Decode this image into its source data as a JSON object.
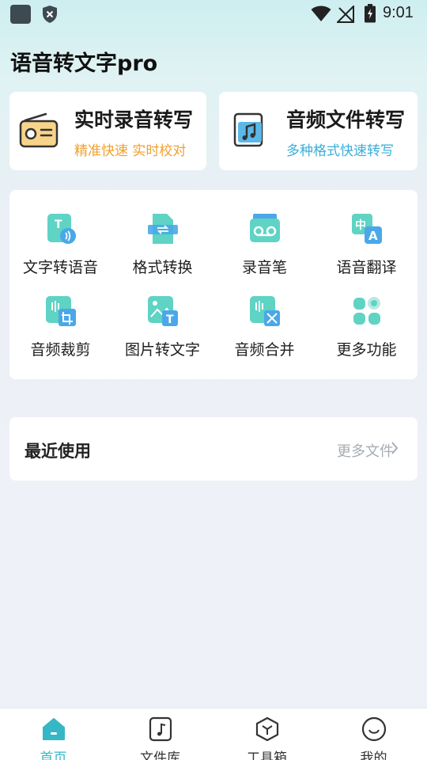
{
  "status_bar": {
    "time": "9:01"
  },
  "app": {
    "title": "语音转文字pro"
  },
  "cards": [
    {
      "title": "实时录音转写",
      "subtitle": "精准快速 实时校对",
      "subtitle_color": "#f0a030"
    },
    {
      "title": "音频文件转写",
      "subtitle": "多种格式快速转写",
      "subtitle_color": "#3aaed8"
    }
  ],
  "tools": [
    {
      "label": "文字转语音",
      "icon": "text-to-speech-icon"
    },
    {
      "label": "格式转换",
      "icon": "format-convert-icon"
    },
    {
      "label": "录音笔",
      "icon": "recorder-icon"
    },
    {
      "label": "语音翻译",
      "icon": "voice-translate-icon"
    },
    {
      "label": "音频裁剪",
      "icon": "audio-crop-icon"
    },
    {
      "label": "图片转文字",
      "icon": "image-to-text-icon"
    },
    {
      "label": "音频合并",
      "icon": "audio-merge-icon"
    },
    {
      "label": "更多功能",
      "icon": "more-features-icon"
    }
  ],
  "recent": {
    "title": "最近使用",
    "more": "更多文件"
  },
  "tabs": [
    {
      "label": "首页",
      "icon": "home-icon",
      "active": true
    },
    {
      "label": "文件库",
      "icon": "file-library-icon",
      "active": false
    },
    {
      "label": "工具箱",
      "icon": "toolbox-icon",
      "active": false
    },
    {
      "label": "我的",
      "icon": "profile-icon",
      "active": false
    }
  ],
  "colors": {
    "accent": "#36b7c6",
    "icon_teal": "#5fd3c4",
    "icon_blue": "#4aa8e8"
  }
}
